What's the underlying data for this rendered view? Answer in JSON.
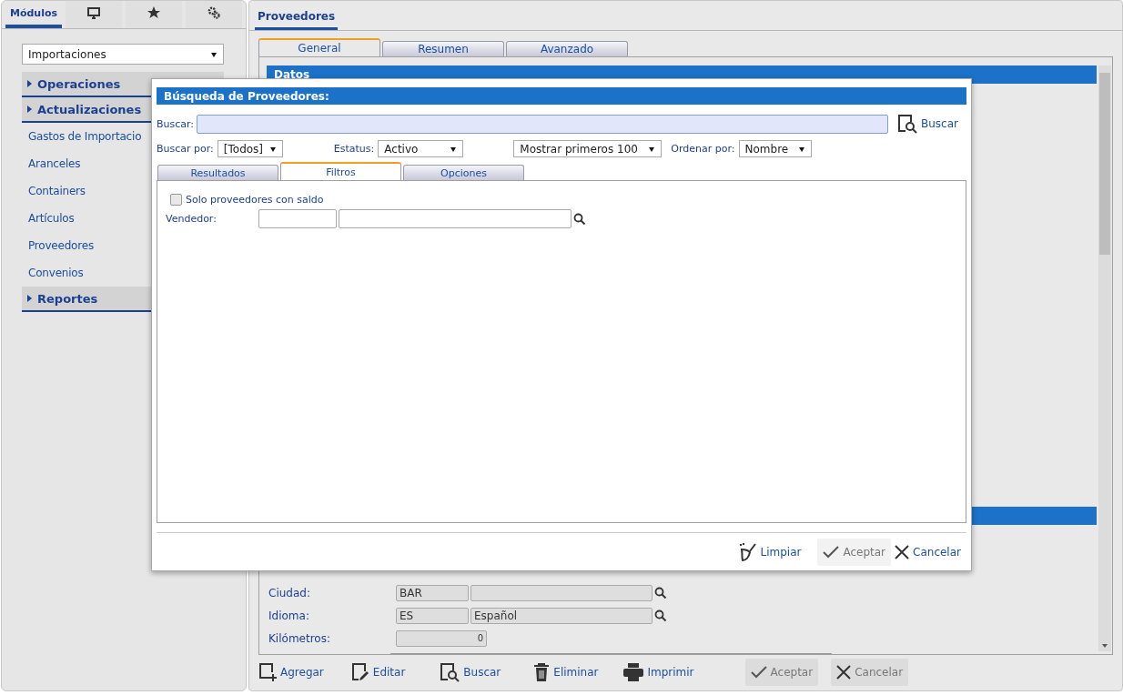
{
  "sidebar": {
    "tabs": [
      {
        "kind": "text",
        "label": "Módulos",
        "selected": true
      },
      {
        "kind": "monitor",
        "selected": false
      },
      {
        "kind": "star",
        "selected": false
      },
      {
        "kind": "gears",
        "selected": false
      }
    ],
    "module_select": {
      "value": "Importaciones"
    },
    "menu": [
      {
        "kind": "group",
        "label": "Operaciones",
        "expanded": false
      },
      {
        "kind": "group",
        "label": "Actualizaciones",
        "expanded": false
      },
      {
        "kind": "item",
        "label": "Gastos de Importacio"
      },
      {
        "kind": "item",
        "label": "Aranceles"
      },
      {
        "kind": "item",
        "label": "Containers"
      },
      {
        "kind": "item",
        "label": "Artículos"
      },
      {
        "kind": "item",
        "label": "Proveedores"
      },
      {
        "kind": "item",
        "label": "Convenios"
      },
      {
        "kind": "group",
        "label": "Reportes",
        "expanded": false
      }
    ]
  },
  "main": {
    "tab": "Proveedores",
    "subtabs": [
      {
        "label": "General",
        "selected": true
      },
      {
        "label": "Resumen",
        "selected": false
      },
      {
        "label": "Avanzado",
        "selected": false
      }
    ],
    "section_title": "Datos",
    "fields": [
      {
        "kind": "lookup",
        "label": "Ciudad:",
        "code": "BAR"
      },
      {
        "kind": "lookup",
        "label": "Idioma:",
        "code": "ES",
        "name": "Español"
      },
      {
        "kind": "number",
        "label": "Kilómetros:",
        "value": "0"
      }
    ],
    "toolbar": [
      {
        "kind": "add",
        "label": "Agregar"
      },
      {
        "kind": "edit",
        "label": "Editar"
      },
      {
        "kind": "search",
        "label": "Buscar"
      },
      {
        "kind": "trash",
        "label": "Eliminar"
      },
      {
        "kind": "print",
        "label": "Imprimir"
      }
    ],
    "actions": [
      {
        "kind": "check",
        "label": "Aceptar",
        "disabled": true
      },
      {
        "kind": "close",
        "label": "Cancelar",
        "disabled": true
      }
    ]
  },
  "dialog": {
    "title": "Búsqueda de Proveedores:",
    "search_label": "Buscar:",
    "search_button": "Buscar",
    "filters": [
      {
        "label": "Buscar por:",
        "value": "[Todos]"
      },
      {
        "label": "Estatus:",
        "value": "Activo"
      },
      {
        "value": "Mostrar primeros 100"
      },
      {
        "label": "Ordenar por:",
        "value": "Nombre"
      }
    ],
    "tabs": [
      {
        "label": "Resultados",
        "selected": false
      },
      {
        "label": "Filtros",
        "selected": true
      },
      {
        "label": "Opciones",
        "selected": false
      }
    ],
    "checkbox": {
      "label": "Solo proveedores con saldo",
      "checked": false
    },
    "vendor_label": "Vendedor:",
    "buttons": [
      {
        "kind": "broom",
        "label": "Limpiar",
        "disabled": false
      },
      {
        "kind": "check",
        "label": "Aceptar",
        "disabled": true
      },
      {
        "kind": "close",
        "label": "Cancelar",
        "disabled": false
      }
    ]
  }
}
